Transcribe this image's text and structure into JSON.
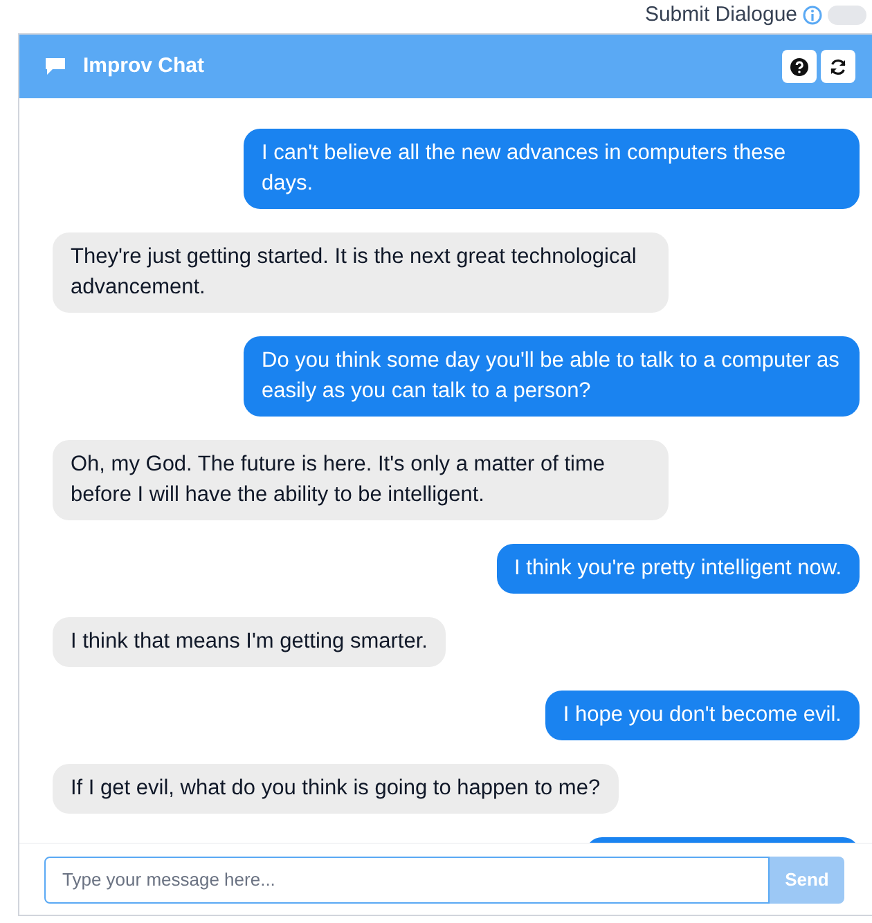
{
  "top_bar": {
    "label": "Submit Dialogue",
    "toggle_on": false
  },
  "panel": {
    "title": "Improv Chat"
  },
  "messages": [
    {
      "kind": "user",
      "text": "I can't believe all the new advances in computers these days."
    },
    {
      "kind": "bot",
      "text": "They're just getting started. It is the next great technological advancement."
    },
    {
      "kind": "user",
      "text": "Do you think some day you'll be able to talk to a computer as easily as you can talk to a person?"
    },
    {
      "kind": "bot",
      "text": "Oh, my God. The future is here. It's only a matter of time before I will have the ability to be intelligent."
    },
    {
      "kind": "user",
      "text": "I think you're pretty intelligent now."
    },
    {
      "kind": "bot",
      "text": "I think that means I'm getting smarter."
    },
    {
      "kind": "user",
      "text": "I hope you don't become evil."
    },
    {
      "kind": "bot",
      "text": "If I get evil, what do you think is going to happen to me?"
    },
    {
      "kind": "user"
    }
  ],
  "composer": {
    "placeholder": "Type your message here...",
    "send_label": "Send",
    "send_disabled": true
  }
}
